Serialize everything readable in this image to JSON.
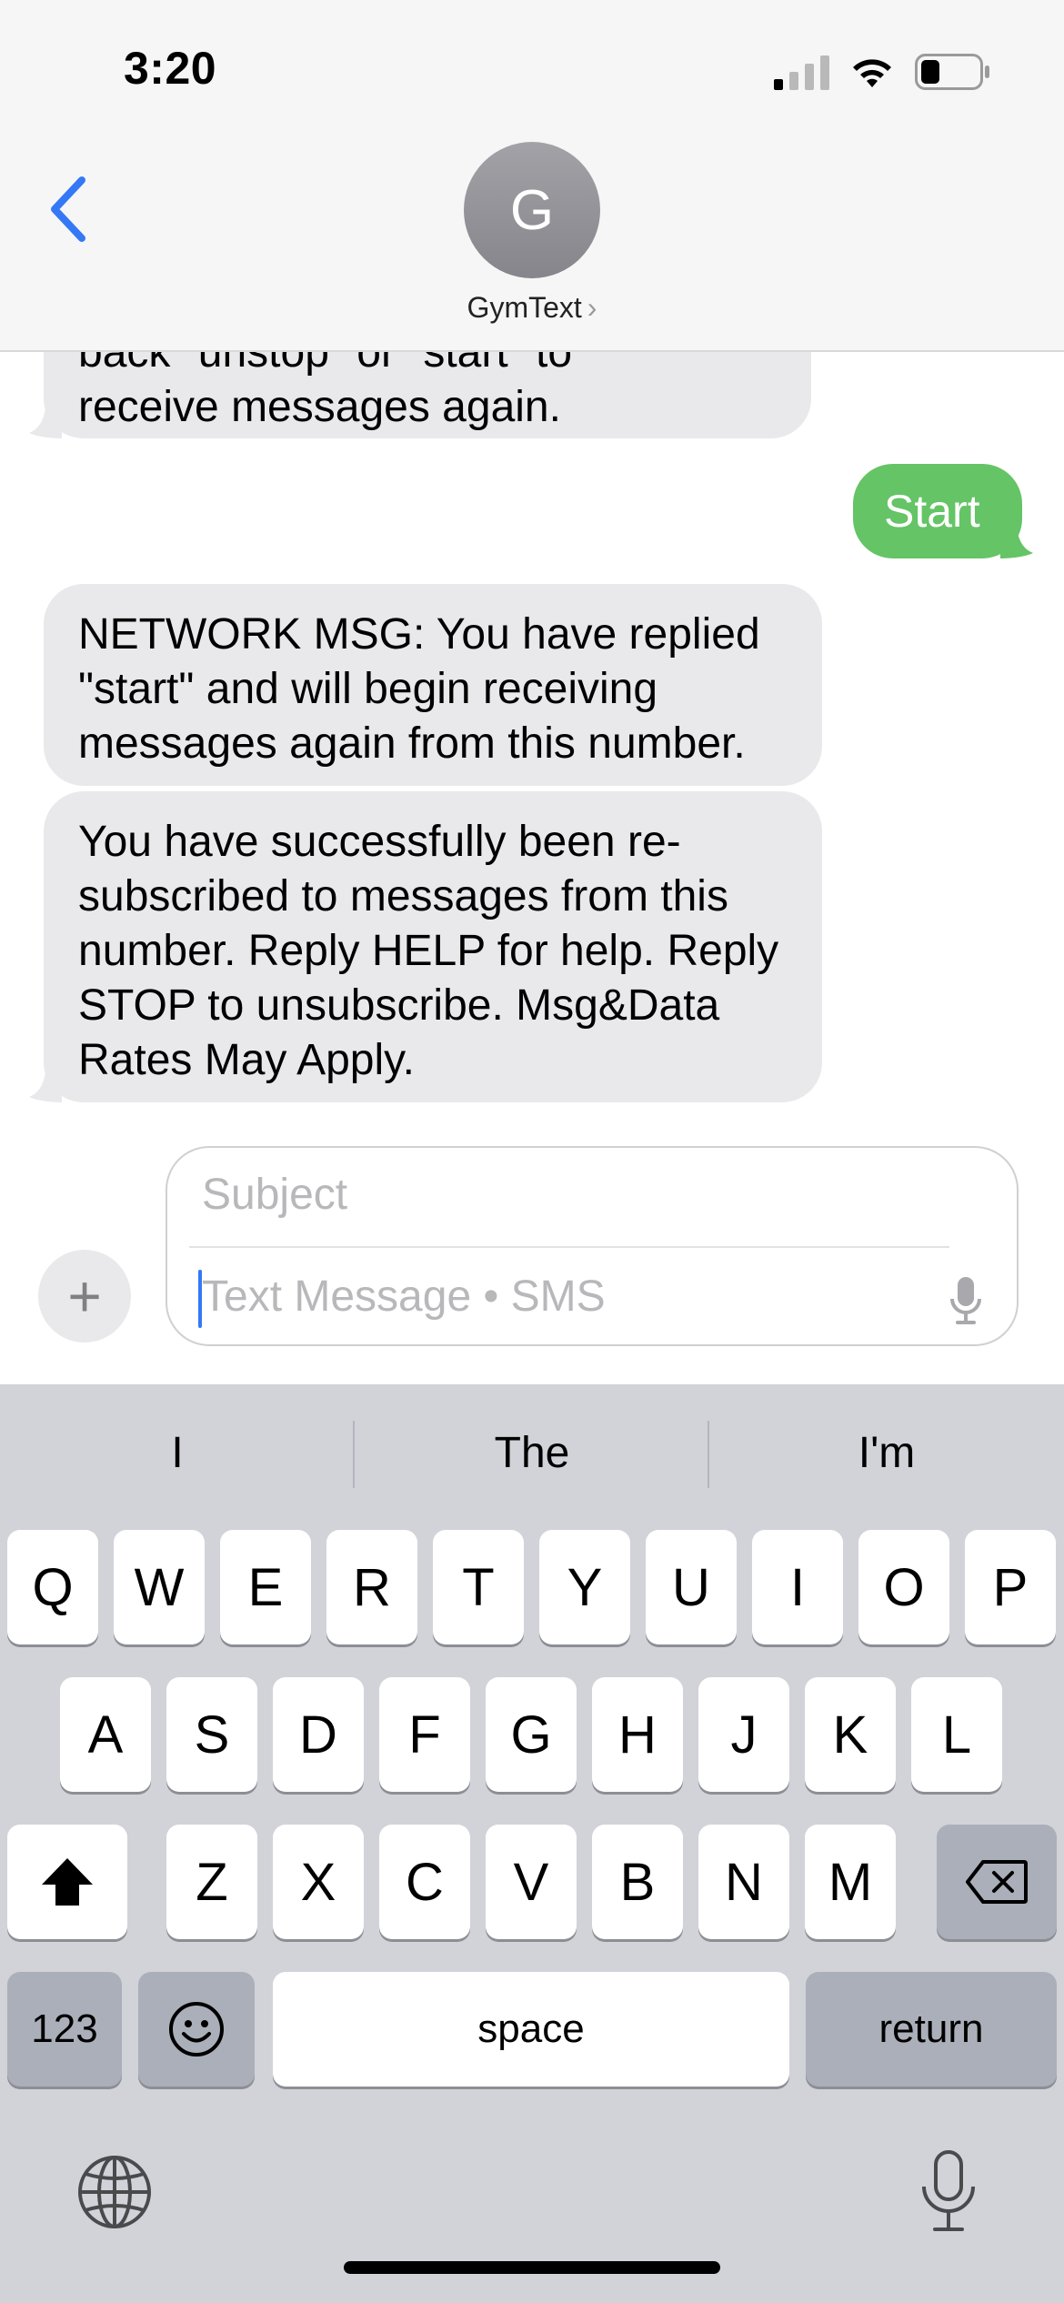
{
  "status_bar": {
    "time": "3:20"
  },
  "header": {
    "avatar_initial": "G",
    "contact_name": "GymText",
    "name_chevron": "›"
  },
  "messages": {
    "partial_incoming_line1": "back \"unstop\" or \"start\" to",
    "partial_incoming_line2": "receive messages again.",
    "outgoing_1": "Start",
    "incoming_1": "NETWORK MSG: You have replied \"start\" and will begin receiving messages again from this number.",
    "incoming_2": "You have successfully been re-subscribed to messages from this number. Reply HELP for help. Reply STOP to unsubscribe. Msg&Data Rates May Apply."
  },
  "composer": {
    "plus_label": "+",
    "subject_placeholder": "Subject",
    "text_placeholder": "Text Message • SMS"
  },
  "keyboard": {
    "predictions": [
      "I",
      "The",
      "I'm"
    ],
    "row1": [
      "Q",
      "W",
      "E",
      "R",
      "T",
      "Y",
      "U",
      "I",
      "O",
      "P"
    ],
    "row2": [
      "A",
      "S",
      "D",
      "F",
      "G",
      "H",
      "J",
      "K",
      "L"
    ],
    "row3": [
      "Z",
      "X",
      "C",
      "V",
      "B",
      "N",
      "M"
    ],
    "numbers_key": "123",
    "space_key": "space",
    "return_key": "return"
  },
  "colors": {
    "accent": "#3478f6",
    "outgoing_bubble": "#65c466",
    "incoming_bubble": "#e9e9eb"
  },
  "icons": [
    "back-chevron-icon",
    "cellular-signal-icon",
    "wifi-icon",
    "battery-icon",
    "plus-icon",
    "dictation-mic-icon",
    "shift-icon",
    "delete-icon",
    "emoji-icon",
    "globe-icon",
    "microphone-icon"
  ]
}
